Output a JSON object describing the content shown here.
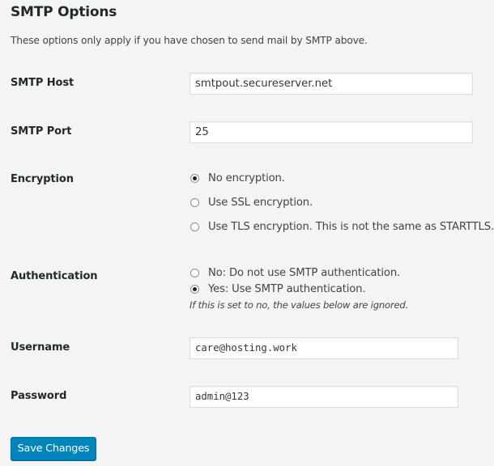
{
  "section": {
    "title": "SMTP Options",
    "description": "These options only apply if you have chosen to send mail by SMTP above."
  },
  "fields": {
    "host": {
      "label": "SMTP Host",
      "value": "smtpout.secureserver.net"
    },
    "port": {
      "label": "SMTP Port",
      "value": "25"
    },
    "encryption": {
      "label": "Encryption",
      "options": [
        {
          "label": "No encryption.",
          "checked": true
        },
        {
          "label": "Use SSL encryption.",
          "checked": false
        },
        {
          "label": "Use TLS encryption. This is not the same as STARTTLS.",
          "checked": false
        }
      ]
    },
    "authentication": {
      "label": "Authentication",
      "options": [
        {
          "label": "No: Do not use SMTP authentication.",
          "checked": false
        },
        {
          "label": "Yes: Use SMTP authentication.",
          "checked": true
        }
      ],
      "hint": "If this is set to no, the values below are ignored."
    },
    "username": {
      "label": "Username",
      "value": "care@hosting.work"
    },
    "password": {
      "label": "Password",
      "value": "admin@123"
    }
  },
  "actions": {
    "save_label": "Save Changes"
  },
  "colors": {
    "primary_button": "#0085ba",
    "background": "#f3f4f4"
  }
}
